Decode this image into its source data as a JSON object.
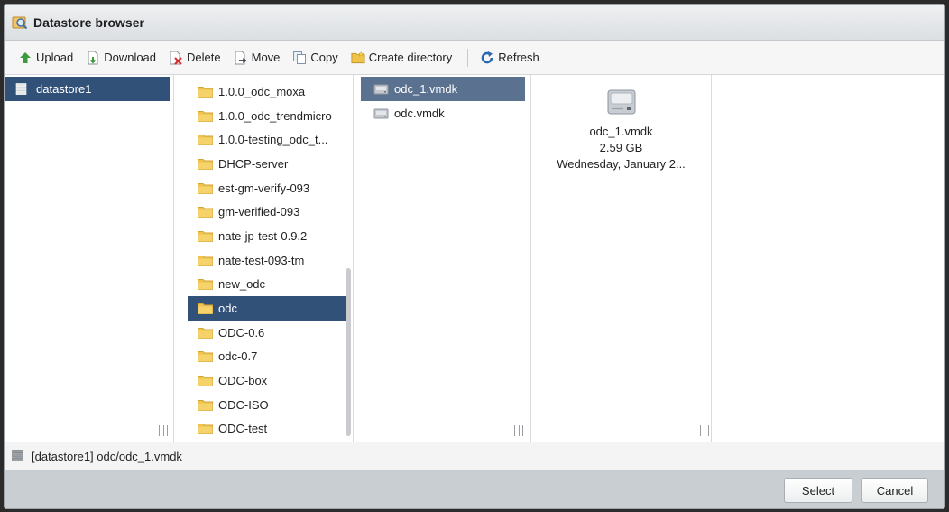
{
  "window": {
    "title": "Datastore browser"
  },
  "toolbar": {
    "upload": "Upload",
    "download": "Download",
    "delete": "Delete",
    "move": "Move",
    "copy": "Copy",
    "create_directory": "Create directory",
    "refresh": "Refresh"
  },
  "datastores": [
    {
      "label": "datastore1",
      "selected": true
    }
  ],
  "folders": [
    {
      "label": "1.0.0_odc_moxa"
    },
    {
      "label": "1.0.0_odc_trendmicro"
    },
    {
      "label": "1.0.0-testing_odc_t..."
    },
    {
      "label": "DHCP-server"
    },
    {
      "label": "est-gm-verify-093"
    },
    {
      "label": "gm-verified-093"
    },
    {
      "label": "nate-jp-test-0.9.2"
    },
    {
      "label": "nate-test-093-tm"
    },
    {
      "label": "new_odc"
    },
    {
      "label": "odc",
      "selected": true
    },
    {
      "label": "ODC-0.6"
    },
    {
      "label": "odc-0.7"
    },
    {
      "label": "ODC-box"
    },
    {
      "label": "ODC-ISO"
    },
    {
      "label": "ODC-test"
    }
  ],
  "files": [
    {
      "label": "odc_1.vmdk",
      "selected": true
    },
    {
      "label": "odc.vmdk"
    }
  ],
  "preview": {
    "name": "odc_1.vmdk",
    "size": "2.59 GB",
    "modified": "Wednesday, January 2..."
  },
  "path": "[datastore1] odc/odc_1.vmdk",
  "footer": {
    "select": "Select",
    "cancel": "Cancel"
  },
  "colors": {
    "selection": "#315178",
    "file_selection": "#5b7190",
    "folder": "#f0c34b"
  },
  "icons": {
    "title": "datastore-browser-icon",
    "upload": "green-arrow-up-icon",
    "download": "download-icon",
    "delete": "delete-icon",
    "move": "move-icon",
    "copy": "copy-icon",
    "create_directory": "folder-icon",
    "refresh": "refresh-icon",
    "datastore": "datastore-icon",
    "folder": "folder-icon",
    "disk": "disk-icon"
  }
}
